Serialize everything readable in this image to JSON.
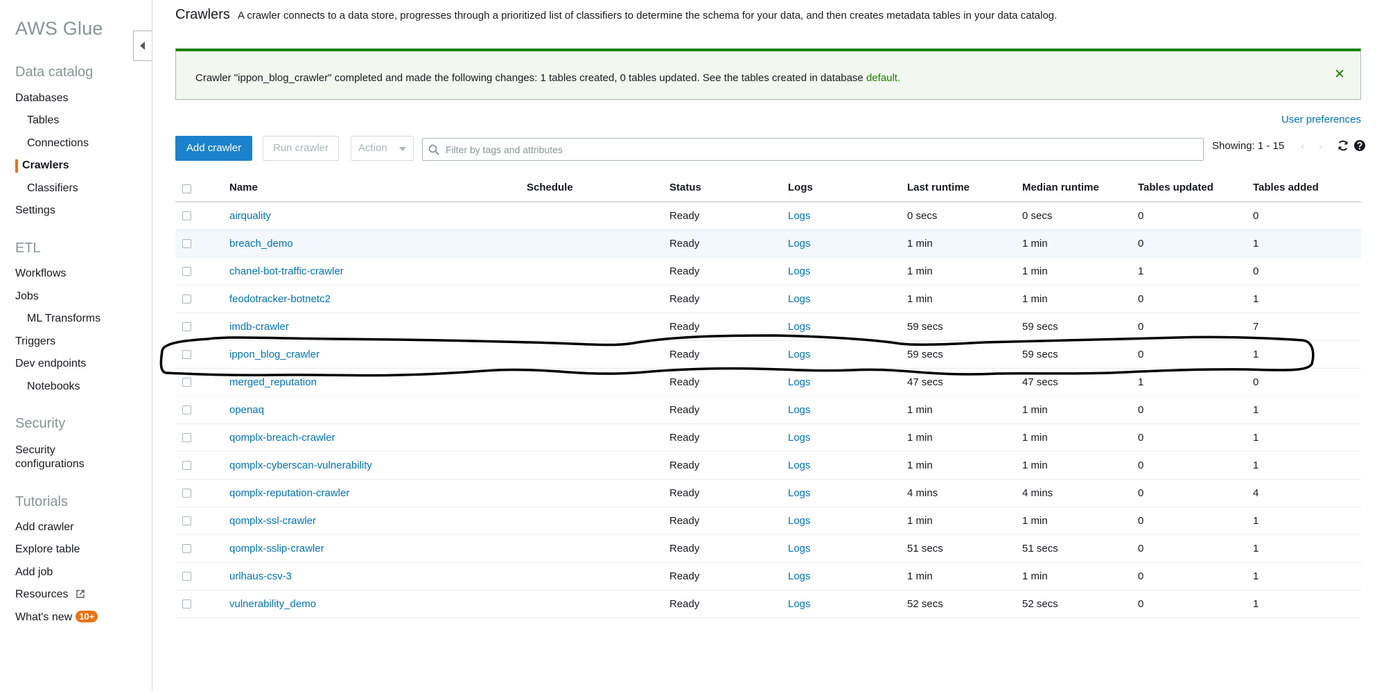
{
  "sidebar": {
    "brand": "AWS Glue",
    "data_catalog": {
      "heading": "Data catalog",
      "databases": "Databases",
      "tables": "Tables",
      "connections": "Connections",
      "crawlers": "Crawlers",
      "classifiers": "Classifiers",
      "settings": "Settings"
    },
    "etl": {
      "heading": "ETL",
      "workflows": "Workflows",
      "jobs": "Jobs",
      "ml_transforms": "ML Transforms",
      "triggers": "Triggers",
      "dev_endpoints": "Dev endpoints",
      "notebooks": "Notebooks"
    },
    "security": {
      "heading": "Security",
      "security_configurations_line1": "Security",
      "security_configurations_line2": "configurations"
    },
    "tutorials": {
      "heading": "Tutorials",
      "add_crawler": "Add crawler",
      "explore_table": "Explore table",
      "add_job": "Add job",
      "resources": "Resources",
      "whats_new": "What's new",
      "whats_new_badge": "10+"
    }
  },
  "header": {
    "title": "Crawlers",
    "description": "A crawler connects to a data store, progresses through a prioritized list of classifiers to determine the schema for your data, and then creates metadata tables in your data catalog."
  },
  "flash": {
    "message": "Crawler \"ippon_blog_crawler\" completed and made the following changes: 1 tables created, 0 tables updated. See the tables created in database",
    "link": "default.",
    "close": "✕"
  },
  "user_preferences": "User preferences",
  "toolbar": {
    "add_crawler": "Add crawler",
    "run_crawler": "Run crawler",
    "action": "Action",
    "filter_placeholder": "Filter by tags and attributes",
    "showing": "Showing: 1 - 15"
  },
  "table": {
    "columns": [
      "Name",
      "Schedule",
      "Status",
      "Logs",
      "Last runtime",
      "Median runtime",
      "Tables updated",
      "Tables added"
    ],
    "rows": [
      {
        "name": "airquality",
        "schedule": "",
        "status": "Ready",
        "logs": "Logs",
        "last": "0 secs",
        "median": "0 secs",
        "updated": "0",
        "added": "0"
      },
      {
        "name": "breach_demo",
        "schedule": "",
        "status": "Ready",
        "logs": "Logs",
        "last": "1 min",
        "median": "1 min",
        "updated": "0",
        "added": "1"
      },
      {
        "name": "chanel-bot-traffic-crawler",
        "schedule": "",
        "status": "Ready",
        "logs": "Logs",
        "last": "1 min",
        "median": "1 min",
        "updated": "1",
        "added": "0"
      },
      {
        "name": "feodotracker-botnetc2",
        "schedule": "",
        "status": "Ready",
        "logs": "Logs",
        "last": "1 min",
        "median": "1 min",
        "updated": "0",
        "added": "1"
      },
      {
        "name": "imdb-crawler",
        "schedule": "",
        "status": "Ready",
        "logs": "Logs",
        "last": "59 secs",
        "median": "59 secs",
        "updated": "0",
        "added": "7"
      },
      {
        "name": "ippon_blog_crawler",
        "schedule": "",
        "status": "Ready",
        "logs": "Logs",
        "last": "59 secs",
        "median": "59 secs",
        "updated": "0",
        "added": "1"
      },
      {
        "name": "merged_reputation",
        "schedule": "",
        "status": "Ready",
        "logs": "Logs",
        "last": "47 secs",
        "median": "47 secs",
        "updated": "1",
        "added": "0"
      },
      {
        "name": "openaq",
        "schedule": "",
        "status": "Ready",
        "logs": "Logs",
        "last": "1 min",
        "median": "1 min",
        "updated": "0",
        "added": "1"
      },
      {
        "name": "qomplx-breach-crawler",
        "schedule": "",
        "status": "Ready",
        "logs": "Logs",
        "last": "1 min",
        "median": "1 min",
        "updated": "0",
        "added": "1"
      },
      {
        "name": "qomplx-cyberscan-vulnerability",
        "schedule": "",
        "status": "Ready",
        "logs": "Logs",
        "last": "1 min",
        "median": "1 min",
        "updated": "0",
        "added": "1"
      },
      {
        "name": "qomplx-reputation-crawler",
        "schedule": "",
        "status": "Ready",
        "logs": "Logs",
        "last": "4 mins",
        "median": "4 mins",
        "updated": "0",
        "added": "4"
      },
      {
        "name": "qomplx-ssl-crawler",
        "schedule": "",
        "status": "Ready",
        "logs": "Logs",
        "last": "1 min",
        "median": "1 min",
        "updated": "0",
        "added": "1"
      },
      {
        "name": "qomplx-sslip-crawler",
        "schedule": "",
        "status": "Ready",
        "logs": "Logs",
        "last": "51 secs",
        "median": "51 secs",
        "updated": "0",
        "added": "1"
      },
      {
        "name": "urlhaus-csv-3",
        "schedule": "",
        "status": "Ready",
        "logs": "Logs",
        "last": "1 min",
        "median": "1 min",
        "updated": "0",
        "added": "1"
      },
      {
        "name": "vulnerability_demo",
        "schedule": "",
        "status": "Ready",
        "logs": "Logs",
        "last": "52 secs",
        "median": "52 secs",
        "updated": "0",
        "added": "1"
      }
    ]
  },
  "colors": {
    "accent_orange": "#ec7211",
    "link_blue": "#0073bb",
    "primary_button": "#1b82cd",
    "success_green": "#1d8102",
    "annotation_ink": "#000000"
  }
}
